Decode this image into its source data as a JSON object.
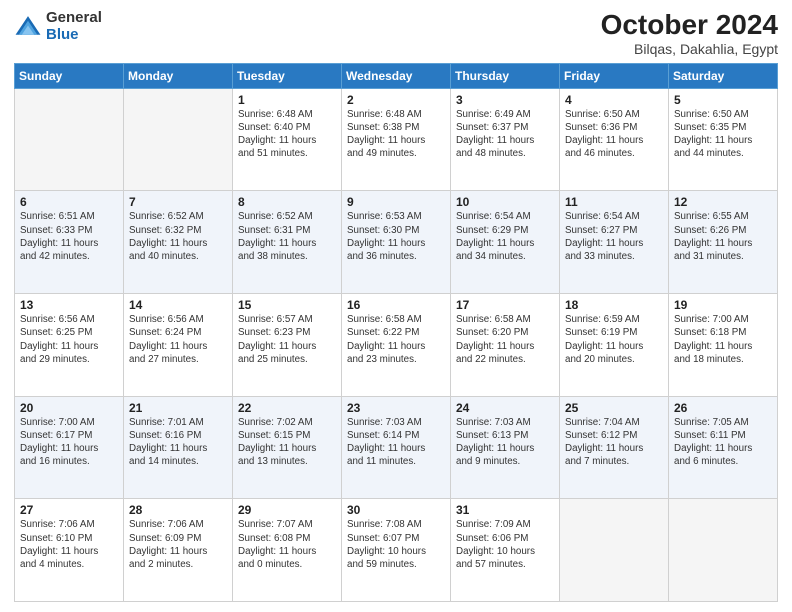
{
  "header": {
    "logo_general": "General",
    "logo_blue": "Blue",
    "month": "October 2024",
    "location": "Bilqas, Dakahlia, Egypt"
  },
  "weekdays": [
    "Sunday",
    "Monday",
    "Tuesday",
    "Wednesday",
    "Thursday",
    "Friday",
    "Saturday"
  ],
  "weeks": [
    [
      {
        "day": "",
        "lines": []
      },
      {
        "day": "",
        "lines": []
      },
      {
        "day": "1",
        "lines": [
          "Sunrise: 6:48 AM",
          "Sunset: 6:40 PM",
          "Daylight: 11 hours",
          "and 51 minutes."
        ]
      },
      {
        "day": "2",
        "lines": [
          "Sunrise: 6:48 AM",
          "Sunset: 6:38 PM",
          "Daylight: 11 hours",
          "and 49 minutes."
        ]
      },
      {
        "day": "3",
        "lines": [
          "Sunrise: 6:49 AM",
          "Sunset: 6:37 PM",
          "Daylight: 11 hours",
          "and 48 minutes."
        ]
      },
      {
        "day": "4",
        "lines": [
          "Sunrise: 6:50 AM",
          "Sunset: 6:36 PM",
          "Daylight: 11 hours",
          "and 46 minutes."
        ]
      },
      {
        "day": "5",
        "lines": [
          "Sunrise: 6:50 AM",
          "Sunset: 6:35 PM",
          "Daylight: 11 hours",
          "and 44 minutes."
        ]
      }
    ],
    [
      {
        "day": "6",
        "lines": [
          "Sunrise: 6:51 AM",
          "Sunset: 6:33 PM",
          "Daylight: 11 hours",
          "and 42 minutes."
        ]
      },
      {
        "day": "7",
        "lines": [
          "Sunrise: 6:52 AM",
          "Sunset: 6:32 PM",
          "Daylight: 11 hours",
          "and 40 minutes."
        ]
      },
      {
        "day": "8",
        "lines": [
          "Sunrise: 6:52 AM",
          "Sunset: 6:31 PM",
          "Daylight: 11 hours",
          "and 38 minutes."
        ]
      },
      {
        "day": "9",
        "lines": [
          "Sunrise: 6:53 AM",
          "Sunset: 6:30 PM",
          "Daylight: 11 hours",
          "and 36 minutes."
        ]
      },
      {
        "day": "10",
        "lines": [
          "Sunrise: 6:54 AM",
          "Sunset: 6:29 PM",
          "Daylight: 11 hours",
          "and 34 minutes."
        ]
      },
      {
        "day": "11",
        "lines": [
          "Sunrise: 6:54 AM",
          "Sunset: 6:27 PM",
          "Daylight: 11 hours",
          "and 33 minutes."
        ]
      },
      {
        "day": "12",
        "lines": [
          "Sunrise: 6:55 AM",
          "Sunset: 6:26 PM",
          "Daylight: 11 hours",
          "and 31 minutes."
        ]
      }
    ],
    [
      {
        "day": "13",
        "lines": [
          "Sunrise: 6:56 AM",
          "Sunset: 6:25 PM",
          "Daylight: 11 hours",
          "and 29 minutes."
        ]
      },
      {
        "day": "14",
        "lines": [
          "Sunrise: 6:56 AM",
          "Sunset: 6:24 PM",
          "Daylight: 11 hours",
          "and 27 minutes."
        ]
      },
      {
        "day": "15",
        "lines": [
          "Sunrise: 6:57 AM",
          "Sunset: 6:23 PM",
          "Daylight: 11 hours",
          "and 25 minutes."
        ]
      },
      {
        "day": "16",
        "lines": [
          "Sunrise: 6:58 AM",
          "Sunset: 6:22 PM",
          "Daylight: 11 hours",
          "and 23 minutes."
        ]
      },
      {
        "day": "17",
        "lines": [
          "Sunrise: 6:58 AM",
          "Sunset: 6:20 PM",
          "Daylight: 11 hours",
          "and 22 minutes."
        ]
      },
      {
        "day": "18",
        "lines": [
          "Sunrise: 6:59 AM",
          "Sunset: 6:19 PM",
          "Daylight: 11 hours",
          "and 20 minutes."
        ]
      },
      {
        "day": "19",
        "lines": [
          "Sunrise: 7:00 AM",
          "Sunset: 6:18 PM",
          "Daylight: 11 hours",
          "and 18 minutes."
        ]
      }
    ],
    [
      {
        "day": "20",
        "lines": [
          "Sunrise: 7:00 AM",
          "Sunset: 6:17 PM",
          "Daylight: 11 hours",
          "and 16 minutes."
        ]
      },
      {
        "day": "21",
        "lines": [
          "Sunrise: 7:01 AM",
          "Sunset: 6:16 PM",
          "Daylight: 11 hours",
          "and 14 minutes."
        ]
      },
      {
        "day": "22",
        "lines": [
          "Sunrise: 7:02 AM",
          "Sunset: 6:15 PM",
          "Daylight: 11 hours",
          "and 13 minutes."
        ]
      },
      {
        "day": "23",
        "lines": [
          "Sunrise: 7:03 AM",
          "Sunset: 6:14 PM",
          "Daylight: 11 hours",
          "and 11 minutes."
        ]
      },
      {
        "day": "24",
        "lines": [
          "Sunrise: 7:03 AM",
          "Sunset: 6:13 PM",
          "Daylight: 11 hours",
          "and 9 minutes."
        ]
      },
      {
        "day": "25",
        "lines": [
          "Sunrise: 7:04 AM",
          "Sunset: 6:12 PM",
          "Daylight: 11 hours",
          "and 7 minutes."
        ]
      },
      {
        "day": "26",
        "lines": [
          "Sunrise: 7:05 AM",
          "Sunset: 6:11 PM",
          "Daylight: 11 hours",
          "and 6 minutes."
        ]
      }
    ],
    [
      {
        "day": "27",
        "lines": [
          "Sunrise: 7:06 AM",
          "Sunset: 6:10 PM",
          "Daylight: 11 hours",
          "and 4 minutes."
        ]
      },
      {
        "day": "28",
        "lines": [
          "Sunrise: 7:06 AM",
          "Sunset: 6:09 PM",
          "Daylight: 11 hours",
          "and 2 minutes."
        ]
      },
      {
        "day": "29",
        "lines": [
          "Sunrise: 7:07 AM",
          "Sunset: 6:08 PM",
          "Daylight: 11 hours",
          "and 0 minutes."
        ]
      },
      {
        "day": "30",
        "lines": [
          "Sunrise: 7:08 AM",
          "Sunset: 6:07 PM",
          "Daylight: 10 hours",
          "and 59 minutes."
        ]
      },
      {
        "day": "31",
        "lines": [
          "Sunrise: 7:09 AM",
          "Sunset: 6:06 PM",
          "Daylight: 10 hours",
          "and 57 minutes."
        ]
      },
      {
        "day": "",
        "lines": []
      },
      {
        "day": "",
        "lines": []
      }
    ]
  ]
}
